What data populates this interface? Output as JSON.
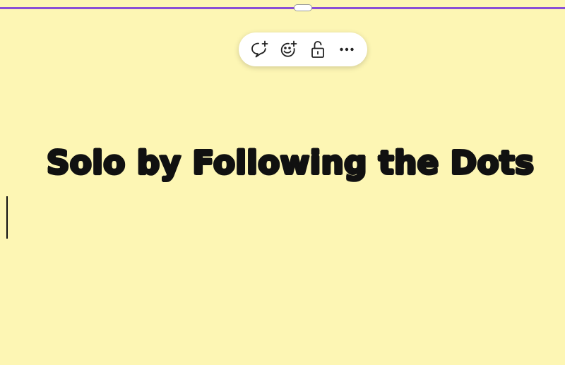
{
  "canvas": {
    "background_color": "#fdf6b4",
    "selection_color": "#8a4fd6"
  },
  "toolbar": {
    "buttons": [
      {
        "icon": "add-comment-icon"
      },
      {
        "icon": "add-reaction-icon"
      },
      {
        "icon": "unlock-icon"
      },
      {
        "icon": "more-options-icon"
      }
    ]
  },
  "note": {
    "text": "Solo by Following the Dots"
  }
}
